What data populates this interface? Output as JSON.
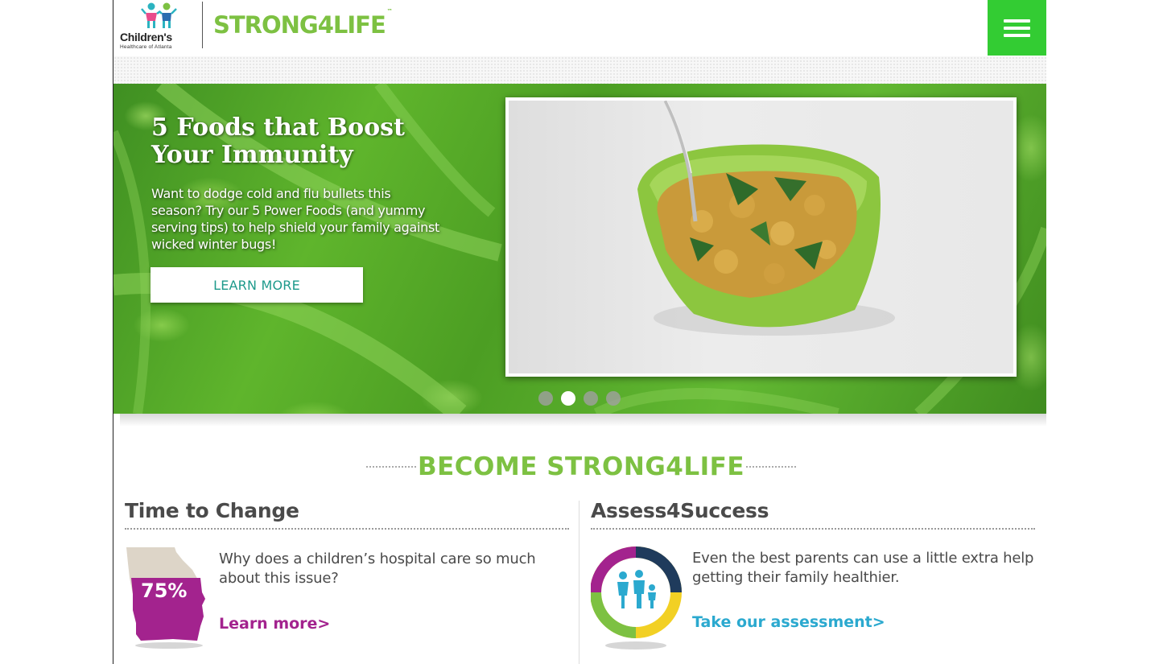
{
  "header": {
    "choa_logo_name": "Children's",
    "choa_logo_sub": "Healthcare of Atlanta",
    "brand_logo": "STRONG4LIFE",
    "menu_icon": "hamburger-menu-icon"
  },
  "hero": {
    "title": "5 Foods that Boost Your Immunity",
    "text": "Want to dodge cold and flu bullets this season? Try our 5 Power Foods (and yummy serving tips) to help shield your family against wicked winter bugs!",
    "button_label": "LEARN MORE",
    "slides": {
      "count": 4,
      "active_index": 1
    }
  },
  "become": {
    "title": "BECOME STRONG4LIFE"
  },
  "cards": [
    {
      "title": "Time to Change",
      "text": "Why does a children’s hospital care so much about this issue?",
      "link": "Learn more>",
      "graphic_label": "75%",
      "icon": "georgia-map-icon",
      "accent": "#a3238e"
    },
    {
      "title": "Assess4Success",
      "text": "Even the best parents can use a little extra help getting their family healthier.",
      "link": "Take our assessment>",
      "icon": "family-ring-icon",
      "accent": "#2ba9cf"
    }
  ],
  "colors": {
    "brand_green": "#7dc142",
    "menu_green": "#33cc33",
    "button_teal": "#1f9a8c"
  }
}
